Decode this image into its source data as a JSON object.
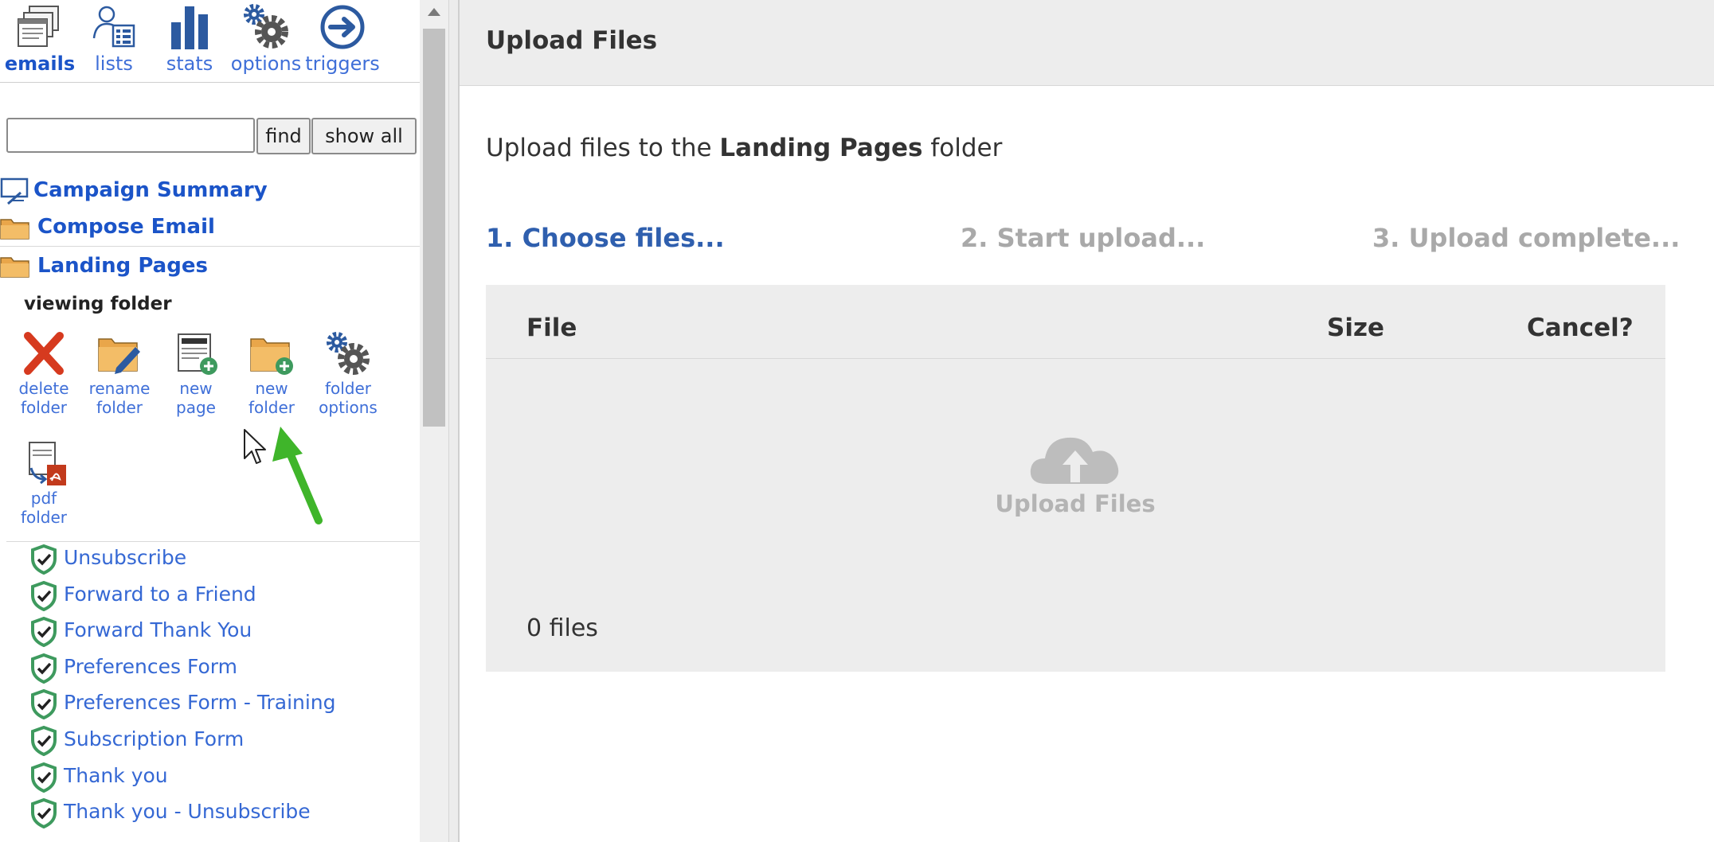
{
  "topnav": {
    "items": [
      {
        "label": "emails",
        "icon": "emails-icon",
        "active": true
      },
      {
        "label": "lists",
        "icon": "lists-icon"
      },
      {
        "label": "stats",
        "icon": "stats-icon"
      },
      {
        "label": "options",
        "icon": "options-gear-icon"
      },
      {
        "label": "triggers",
        "icon": "triggers-arrow-icon"
      }
    ]
  },
  "search": {
    "value": "",
    "find_label": "find",
    "show_all_label": "show all"
  },
  "tree": {
    "campaign_summary": "Campaign Summary",
    "compose_email": "Compose Email",
    "landing_pages": "Landing Pages",
    "viewing_label": "viewing  folder"
  },
  "folder_tools": [
    {
      "label": "delete\nfolder",
      "icon": "delete-x-icon"
    },
    {
      "label": "rename\nfolder",
      "icon": "rename-folder-icon"
    },
    {
      "label": "new\npage",
      "icon": "new-page-icon"
    },
    {
      "label": "new\nfolder",
      "icon": "new-folder-icon"
    },
    {
      "label": "folder\noptions",
      "icon": "folder-options-icon"
    },
    {
      "label": "pdf\nfolder",
      "icon": "pdf-folder-icon"
    }
  ],
  "pages": [
    "Unsubscribe",
    "Forward to a Friend",
    "Forward Thank You",
    "Preferences Form",
    "Preferences Form - Training",
    "Subscription Form",
    "Thank you",
    "Thank you - Unsubscribe"
  ],
  "main": {
    "title": "Upload Files",
    "intro_prefix": "Upload files to the ",
    "intro_folder": "Landing Pages",
    "intro_suffix": " folder",
    "steps": [
      {
        "label": "1. Choose files...",
        "active": true
      },
      {
        "label": "2. Start upload...",
        "active": false
      },
      {
        "label": "3. Upload complete...",
        "active": false
      }
    ],
    "columns": {
      "file": "File",
      "size": "Size",
      "cancel": "Cancel?"
    },
    "dropzone_label": "Upload Files",
    "file_count": "0 files"
  },
  "colors": {
    "link_blue": "#1b54c8",
    "step_active": "#2f5fae",
    "step_inactive": "#a9a9a9",
    "pointer_arrow": "#3fb52a",
    "shield_green": "#3e9a5e"
  }
}
